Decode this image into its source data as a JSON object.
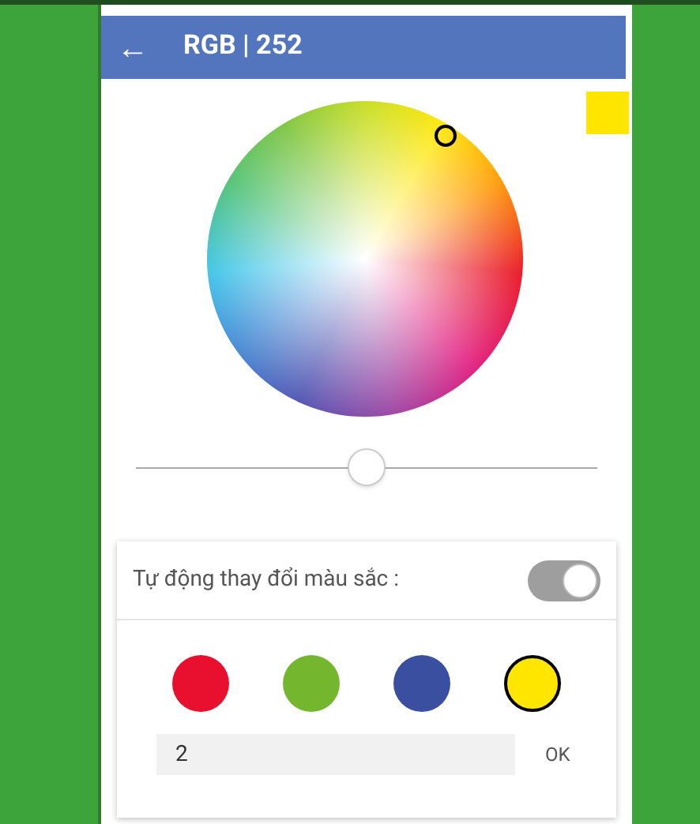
{
  "header": {
    "back_icon": "←",
    "title": "RGB | 252"
  },
  "preview": {
    "color": "#ffe600"
  },
  "brightness_slider": {
    "level": 0.5
  },
  "auto_color_change": {
    "label": "Tự động thay đổi màu sắc :",
    "on": true
  },
  "swatches": [
    {
      "color": "#e8102e",
      "selected": false
    },
    {
      "color": "#74b72e",
      "selected": false
    },
    {
      "color": "#3b4fa0",
      "selected": false
    },
    {
      "color": "#ffe600",
      "selected": true
    }
  ],
  "speed_field": {
    "value": "2"
  },
  "ok_button": "OK"
}
